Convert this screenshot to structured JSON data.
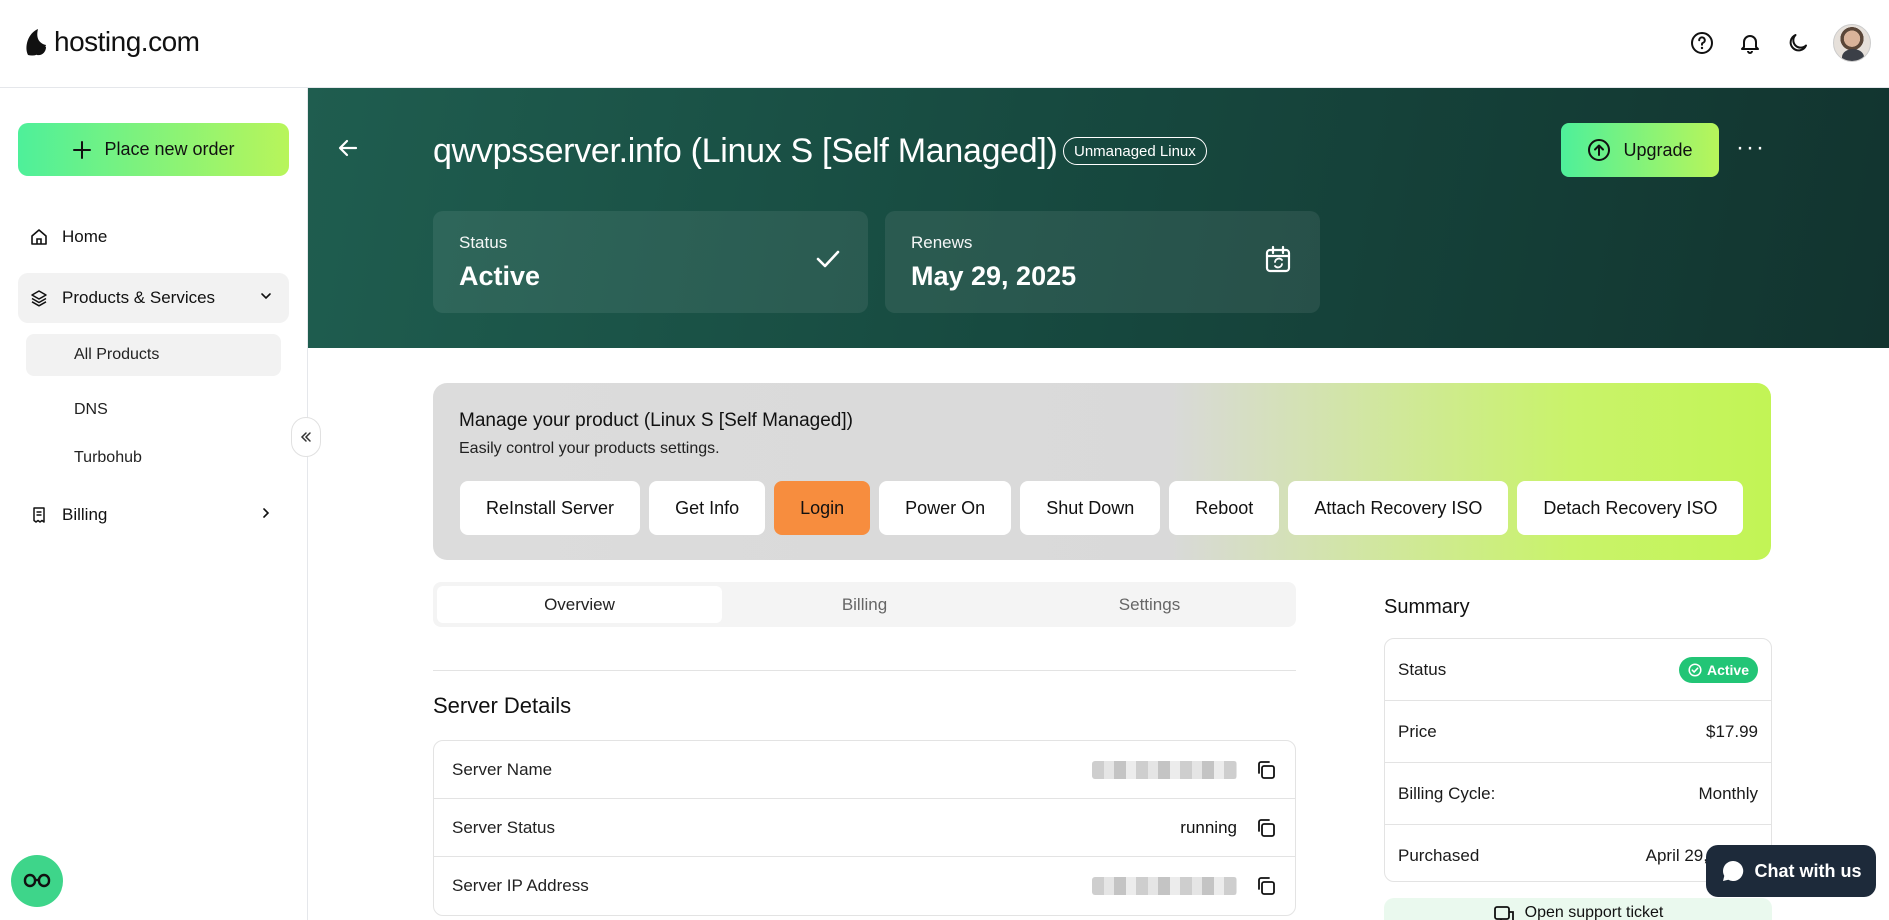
{
  "brand": {
    "name": "hosting.com"
  },
  "sidebar": {
    "new_order_label": "Place new order",
    "home_label": "Home",
    "products_label": "Products & Services",
    "sub_items": [
      "All Products",
      "DNS",
      "Turbohub"
    ],
    "billing_label": "Billing"
  },
  "hero": {
    "title": "qwvpsserver.info (Linux S [Self Managed])",
    "badge": "Unmanaged Linux",
    "upgrade_label": "Upgrade",
    "more_label": "···",
    "status_label": "Status",
    "status_value": "Active",
    "renews_label": "Renews",
    "renews_value": "May 29, 2025"
  },
  "manage": {
    "title": "Manage your product (Linux S [Self Managed])",
    "subtitle": "Easily control your products settings.",
    "actions": [
      "ReInstall Server",
      "Get Info",
      "Login",
      "Power On",
      "Shut Down",
      "Reboot",
      "Attach Recovery ISO",
      "Detach Recovery ISO"
    ]
  },
  "tabs": [
    "Overview",
    "Billing",
    "Settings"
  ],
  "server_details": {
    "title": "Server Details",
    "rows": [
      {
        "label": "Server Name",
        "value": ""
      },
      {
        "label": "Server Status",
        "value": "running"
      },
      {
        "label": "Server IP Address",
        "value": ""
      }
    ]
  },
  "summary": {
    "title": "Summary",
    "status_label": "Status",
    "status_value": "Active",
    "price_label": "Price",
    "price_value": "$17.99",
    "cycle_label": "Billing Cycle:",
    "cycle_value": "Monthly",
    "purchased_label": "Purchased",
    "purchased_value": "April 29,"
  },
  "support_label": "Open support ticket",
  "chat_label": "Chat with us",
  "colors": {
    "accent_green": "#22c576",
    "login_orange": "#f78d3e",
    "hero_dark": "#174a40",
    "chat_dark": "#1d2a3a"
  }
}
